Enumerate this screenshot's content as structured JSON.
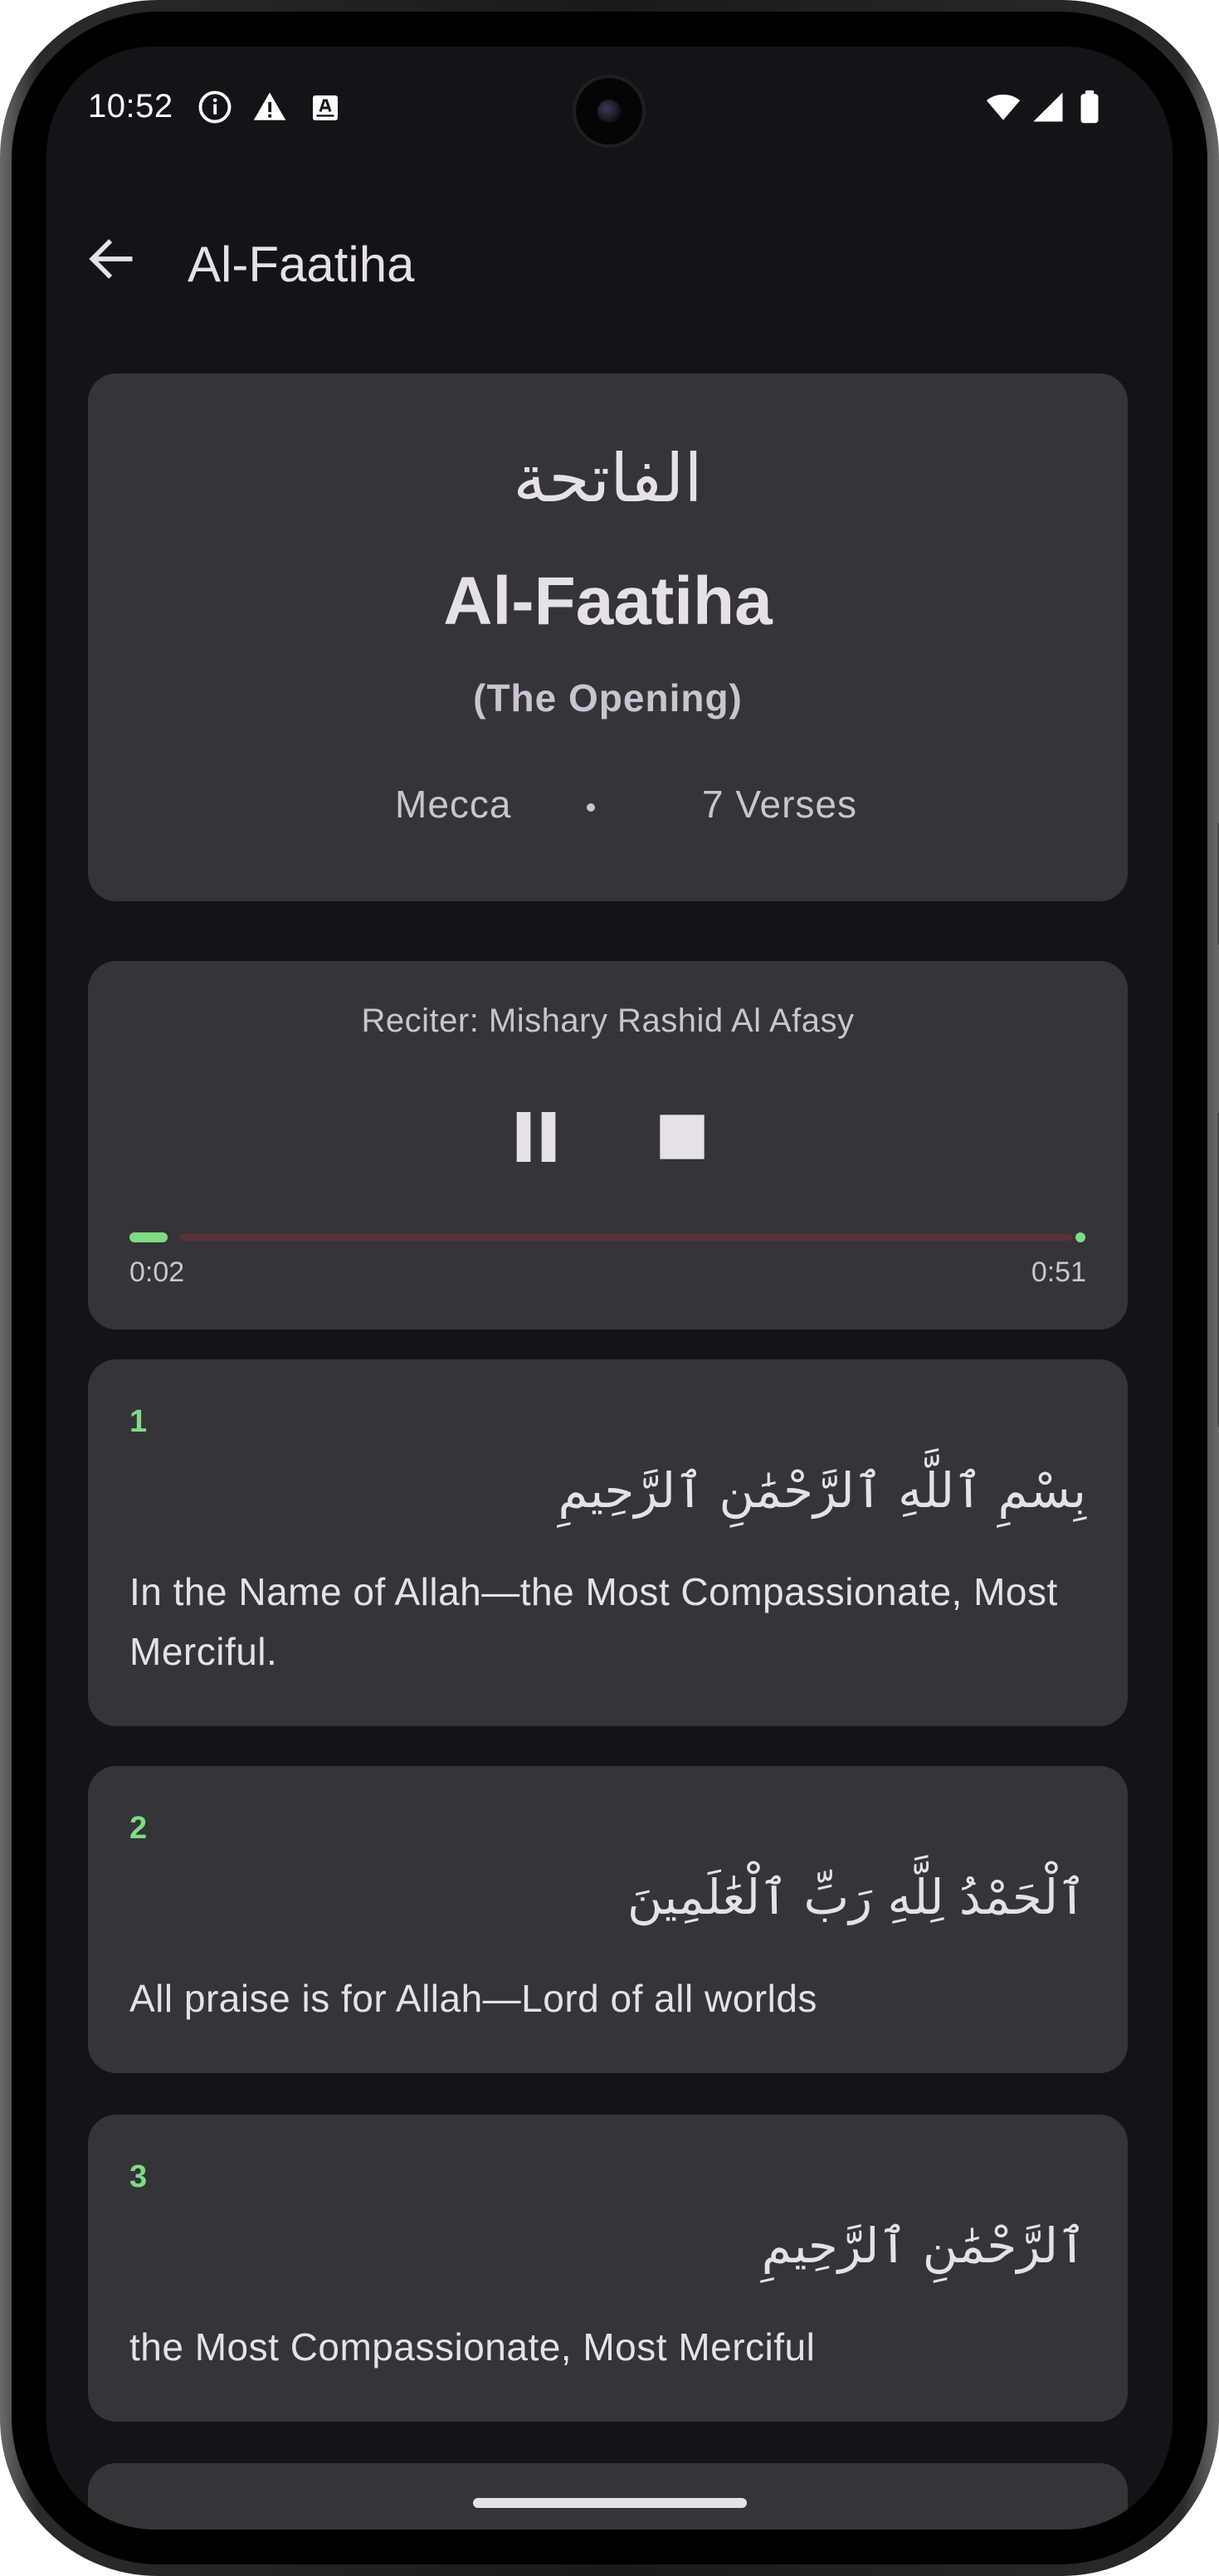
{
  "status_bar": {
    "time": "10:52",
    "left_icons": [
      "info-icon",
      "alert-triangle-icon",
      "auto-text-icon"
    ],
    "right_icons": [
      "wifi-icon",
      "cellular-icon",
      "battery-icon"
    ]
  },
  "app_bar": {
    "back_icon": "arrow-left-icon",
    "title": "Al-Faatiha"
  },
  "surah": {
    "arabic_name": "الفاتحة",
    "english_name": "Al-Faatiha",
    "meaning": "(The Opening)",
    "revelation_place": "Mecca",
    "verse_count": "7 Verses"
  },
  "player": {
    "reciter": "Reciter: Mishary Rashid Al Afasy",
    "pause_icon": "pause-icon",
    "stop_icon": "stop-icon",
    "elapsed": "0:02",
    "total": "0:51",
    "progress": 0.04,
    "colors": {
      "played": "#7ddc84",
      "remaining": "#5a3238"
    }
  },
  "verses": [
    {
      "number": "1",
      "arabic": "بِسْمِ ٱللَّهِ ٱلرَّحْمَٰنِ ٱلرَّحِيمِ",
      "translation": "In the Name of Allah—the Most Compassionate, Most Merciful."
    },
    {
      "number": "2",
      "arabic": "ٱلْحَمْدُ لِلَّهِ رَبِّ ٱلْعَٰلَمِينَ",
      "translation": "All praise is for Allah—Lord of all worlds"
    },
    {
      "number": "3",
      "arabic": "ٱلرَّحْمَٰنِ ٱلرَّحِيمِ",
      "translation": "the Most Compassionate, Most Merciful"
    }
  ],
  "colors": {
    "background": "#141317",
    "card": "#353439",
    "accent": "#7ddc84",
    "text_primary": "#e6e1e9",
    "text_secondary": "#cac4cf"
  }
}
